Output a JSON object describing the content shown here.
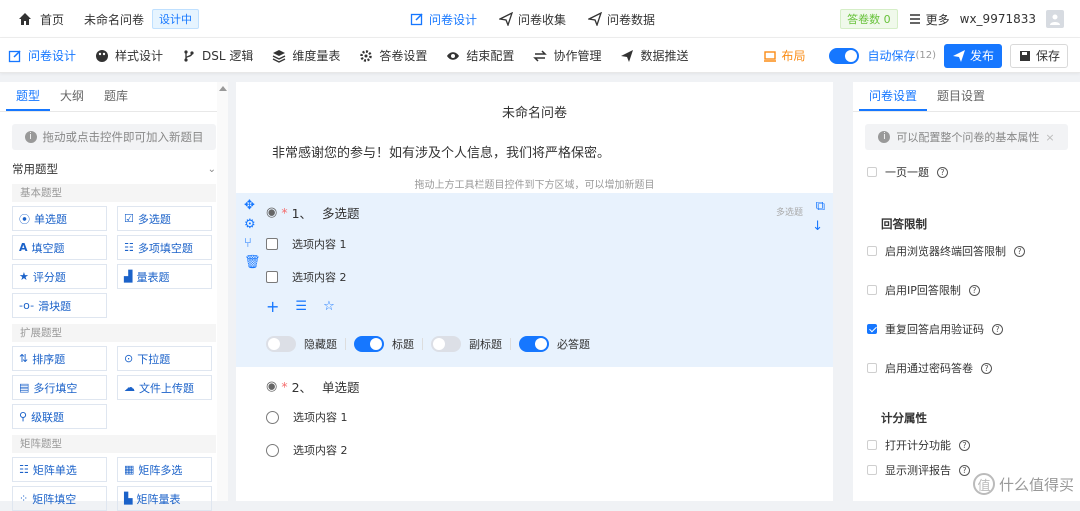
{
  "topbar": {
    "home": "首页",
    "doc_title": "未命名问卷",
    "status_badge": "设计中",
    "nav": [
      "问卷设计",
      "问卷收集",
      "问卷数据"
    ],
    "answers_badge": "答卷数 0",
    "more": "更多",
    "user": "wx_9971833"
  },
  "toolbar": {
    "items": [
      "问卷设计",
      "样式设计",
      "DSL 逻辑",
      "维度量表",
      "答卷设置",
      "结束配置",
      "协作管理",
      "数据推送"
    ],
    "layout": "布局",
    "autosave": "自动保存",
    "autosave_count": "(12)",
    "publish": "发布",
    "save": "保存"
  },
  "left": {
    "tabs": [
      "题型",
      "大纲",
      "题库"
    ],
    "hint": "拖动或点击控件即可加入新题目",
    "group": "常用题型",
    "sections": [
      {
        "title": "基本题型",
        "items": [
          "单选题",
          "多选题",
          "填空题",
          "多项填空题",
          "评分题",
          "量表题",
          "滑块题"
        ]
      },
      {
        "title": "扩展题型",
        "items": [
          "排序题",
          "下拉题",
          "多行填空",
          "文件上传题",
          "级联题"
        ]
      },
      {
        "title": "矩阵题型",
        "items": [
          "矩阵单选",
          "矩阵多选",
          "矩阵填空",
          "矩阵量表"
        ]
      }
    ]
  },
  "canvas": {
    "title": "未命名问卷",
    "description": "非常感谢您的参与！如有涉及个人信息，我们将严格保密。",
    "drop_hint": "拖动上方工具栏题目控件到下方区域，可以增加新题目",
    "q1": {
      "star": "*",
      "number": "1、",
      "title": "多选题",
      "type_tag": "多选题",
      "options": [
        "选项内容 1",
        "选项内容 2"
      ],
      "switches": [
        "隐藏题",
        "标题",
        "副标题",
        "必答题"
      ]
    },
    "q2": {
      "star": "*",
      "number": "2、",
      "title": "单选题",
      "options": [
        "选项内容 1",
        "选项内容 2"
      ]
    }
  },
  "right": {
    "tabs": [
      "问卷设置",
      "题目设置"
    ],
    "hint": "可以配置整个问卷的基本属性",
    "one_page": "一页一题",
    "answer_limit_title": "回答限制",
    "limits": [
      "启用浏览器终端回答限制",
      "启用IP回答限制",
      "重复回答启用验证码",
      "启用通过密码答卷"
    ],
    "score_title": "计分属性",
    "score_items": [
      "打开计分功能",
      "显示测评报告"
    ]
  },
  "watermark": "什么值得买",
  "colors": {
    "primary": "#1677ff",
    "q1_bg": "#e8f2fd",
    "orange": "#fa8c16"
  }
}
